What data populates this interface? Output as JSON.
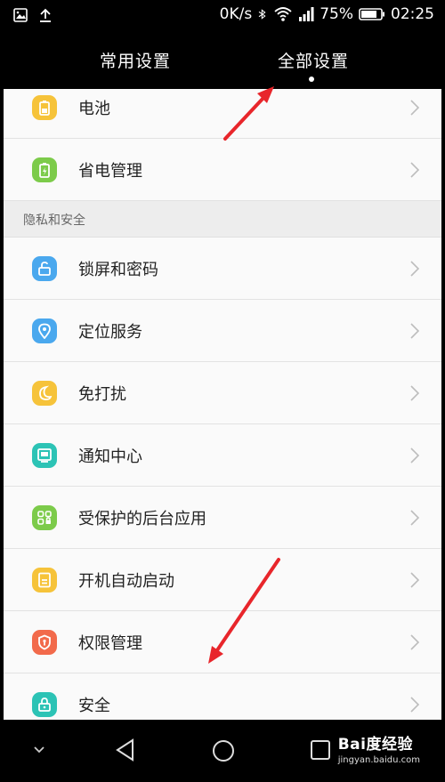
{
  "status_bar": {
    "speed": "0K/s",
    "battery_pct": "75%",
    "time": "02:25",
    "icons": [
      "gallery-icon",
      "upload-icon",
      "bluetooth-icon",
      "wifi-icon",
      "signal-icon",
      "battery-icon"
    ]
  },
  "tabs": [
    {
      "label": "常用设置",
      "selected": false
    },
    {
      "label": "全部设置",
      "selected": true
    }
  ],
  "list": {
    "top_items": [
      {
        "label": "电池",
        "icon": "battery-icon",
        "color": "#f6c33a"
      },
      {
        "label": "省电管理",
        "icon": "power-saving-icon",
        "color": "#7ccb4a"
      }
    ],
    "section_privacy": "隐私和安全",
    "privacy_items": [
      {
        "label": "锁屏和密码",
        "icon": "lock-screen-icon",
        "color": "#4aa8ee"
      },
      {
        "label": "定位服务",
        "icon": "location-icon",
        "color": "#4aa8ee"
      },
      {
        "label": "免打扰",
        "icon": "moon-icon",
        "color": "#f6c33a"
      },
      {
        "label": "通知中心",
        "icon": "notification-icon",
        "color": "#2cc3b5"
      },
      {
        "label": "受保护的后台应用",
        "icon": "protected-apps-icon",
        "color": "#7ccb4a"
      },
      {
        "label": "开机自动启动",
        "icon": "autostart-icon",
        "color": "#f6c33a"
      },
      {
        "label": "权限管理",
        "icon": "permission-icon",
        "color": "#f26a4b"
      },
      {
        "label": "安全",
        "icon": "security-icon",
        "color": "#2cc3b5"
      }
    ]
  },
  "nav": {
    "icons": [
      "collapse-chevron-icon",
      "back-icon",
      "home-icon",
      "recents-icon"
    ]
  },
  "watermark": {
    "main": "Bai度经验",
    "sub": "jingyan.baidu.com"
  },
  "colors": {
    "accent_arrow": "#e8262b",
    "chevron": "#bdbdbd",
    "background": "#f7f7f7"
  }
}
